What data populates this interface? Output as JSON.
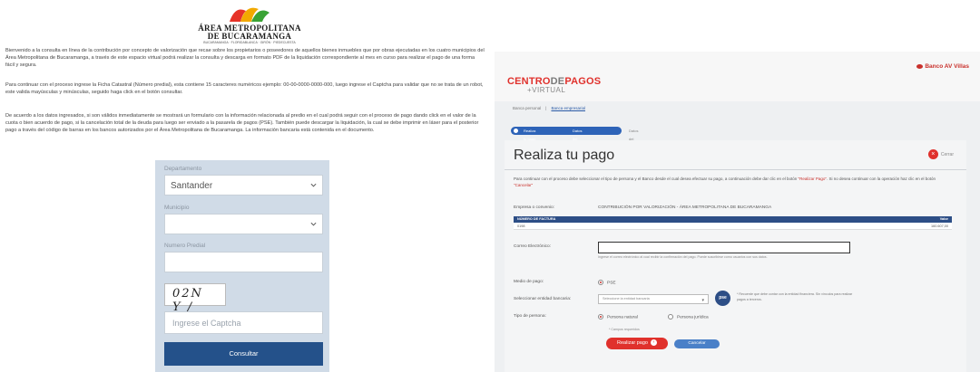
{
  "left_panel": {
    "logo": {
      "line1": "ÁREA METROPOLITANA",
      "line2": "DE BUCARAMANGA",
      "line3": "BUCARAMANGA · FLORIDABLANCA · GIRÓN · PIEDECUESTA"
    },
    "paragraphs": [
      "Bienvenido a la consulta en línea de la contribución por concepto de valorización que recae sobre los propietarios o poseedores de aquellos bienes inmuebles que por obras ejecutadas en los cuatro municipios del Área Metropolitana de Bucaramanga, a través de este espacio virtual podrá realizar la consulta y descarga en formato PDF de la liquidación correspondiente al mes en curso para realizar el pago de una forma fácil y segura.",
      "Para continuar con el proceso ingrese la Ficha Catastral (Número predial), esta contiene 15 caracteres numéricos ejemplo: 00-00-0000-0000-000, luego ingrese el Captcha para validar que no se trata de un robot, este valida mayúsculas y minúsculas, seguido haga click en el botón consultar.",
      "De acuerdo a los datos ingresados, si son válidos inmediatamente se mostrará un formulario con la información relacionada al predio en el cual podrá seguir con el proceso de pago dando click en el valor de la cuota o bien acuerdo de pago, si la cancelación total de la deuda para luego ser enviado a la pasarela de pagos (PSE). También puede descargar la liquidación, la cual se debe imprimir en láser para el posterior pago a través del código de barras en los bancos autorizados por el Área Metropolitana de Bucaramanga. La información bancaria está contenida en el documento."
    ],
    "form": {
      "departamento_label": "Departamento",
      "departamento_value": "Santander",
      "municipio_label": "Municipio",
      "municipio_value": "",
      "numero_predial_label": "Numero Predial",
      "captcha_text": "02N Y /",
      "captcha_placeholder": "Ingrese el Captcha",
      "consultar_label": "Consultar"
    }
  },
  "right_panel": {
    "logo_centro": "CENTRO",
    "logo_de": "DE",
    "logo_pagos": "PAGOS",
    "logo_virtual": "VIRTUAL",
    "bank_logo": "Banco AV Villas",
    "breadcrumb": {
      "item1": "Banca personal",
      "item2": "Banca empresarial"
    },
    "steps": [
      "Realiza tu pago",
      "Datos del comercio"
    ],
    "steps_tail": "Datos del banco",
    "title": "Realiza tu pago",
    "close_label": "Cerrar",
    "instructions_a": "Para continuar con el proceso debe seleccionar el tipo de persona y el Banco desde el cual desea efectuar su pago, a continuación debe dar clic en el botón ",
    "instructions_b": "\"Realizar Pago\"",
    "instructions_c": ". Si no desea continuar con la operación haz clic en el botón ",
    "instructions_d": "\"Cancelar\"",
    "empresa_label": "Empresa o convenio:",
    "empresa_value": "CONTRIBUCIÓN POR VALORIZACIÓN - ÁREA METROPOLITANA DE BUCARAMANGA",
    "invoice_header_left": "NÚMERO DE FACTURA",
    "invoice_header_right": "Valor",
    "invoice_number": "0198",
    "invoice_value": "160.607,00",
    "email_label": "Correo Electrónico:",
    "email_hint": "Ingrese el correo electrónico al cual recibir la confirmación del pago. Puede suscribirse como usuarios con sus datos.",
    "medio_label": "Medio de pago:",
    "medio_value": "PSE",
    "banco_label": "Seleccionar entidad bancaria:",
    "banco_placeholder": "Seleccione la entidad bancaria",
    "pse_icon_text": "pse",
    "pse_note": "* Recuerde que debe contar con la entidad financiera. Sin vínculos para realizar pagos a terceros.",
    "tipo_label": "Tipo de persona:",
    "persona_natural": "Persona natural",
    "persona_juridica": "Persona jurídica",
    "required_note": "* Campos requeridos",
    "realizar_label": "Realizar pago",
    "cancelar_label": "Cancelar"
  },
  "colors": {
    "navy_button": "#24518a",
    "form_bg": "#d0dbe7",
    "brand_red": "#e0312c",
    "invoice_header": "#2d4e86"
  }
}
